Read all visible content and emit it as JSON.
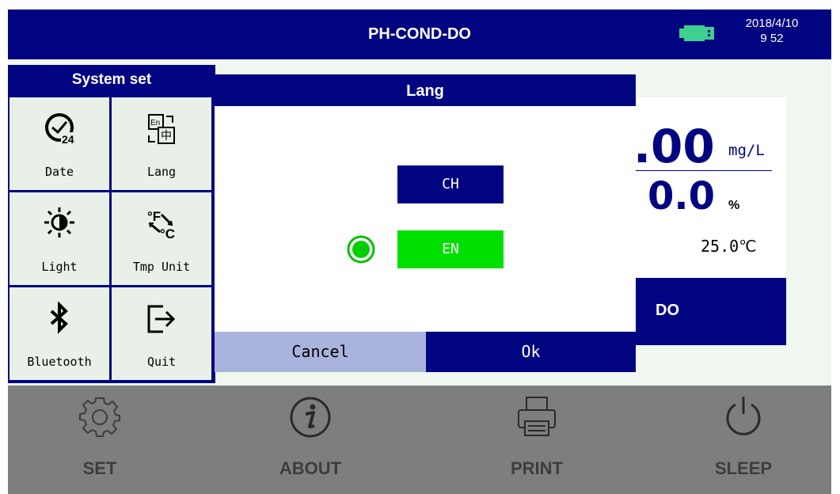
{
  "header": {
    "title": "PH-COND-DO",
    "date": "2018/4/10",
    "time": "9 52"
  },
  "measurement": {
    "do_value": ".00",
    "do_unit": "mg/L",
    "sat_value": "0.0",
    "sat_unit": "%",
    "temperature": "25.0℃",
    "tab_label": "DO"
  },
  "system_set": {
    "title": "System set",
    "items": [
      {
        "label": "Date",
        "icon": "clock-24-icon"
      },
      {
        "label": "Lang",
        "icon": "language-icon"
      },
      {
        "label": "Light",
        "icon": "brightness-icon"
      },
      {
        "label": "Tmp Unit",
        "icon": "temperature-unit-icon"
      },
      {
        "label": "Bluetooth",
        "icon": "bluetooth-icon"
      },
      {
        "label": "Quit",
        "icon": "exit-icon"
      }
    ]
  },
  "lang_dialog": {
    "title": "Lang",
    "options": [
      {
        "label": "CH",
        "selected": false
      },
      {
        "label": "EN",
        "selected": true
      }
    ],
    "cancel_label": "Cancel",
    "ok_label": "Ok"
  },
  "bottom_nav": [
    {
      "label": "SET",
      "icon": "gear-icon"
    },
    {
      "label": "ABOUT",
      "icon": "info-icon"
    },
    {
      "label": "PRINT",
      "icon": "printer-icon"
    },
    {
      "label": "SLEEP",
      "icon": "power-icon"
    }
  ],
  "colors": {
    "navy": "#010480",
    "selected_green": "#00e000",
    "tile_bg": "#e8f0e8",
    "cancel_bg": "#a9b3dc",
    "bottom_bar": "#7e7e7e"
  }
}
